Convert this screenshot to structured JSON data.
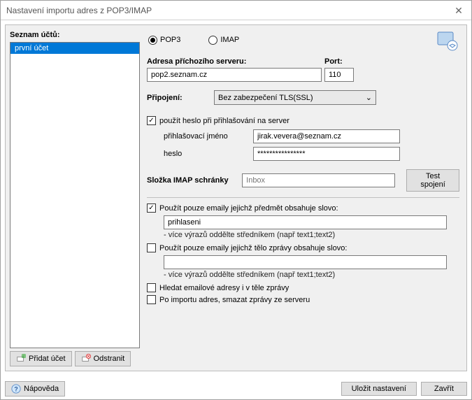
{
  "window": {
    "title": "Nastavení importu adres z POP3/IMAP"
  },
  "left": {
    "header": "Seznam účtů:",
    "accounts": [
      "první účet"
    ],
    "add_label": "Přidat účet",
    "remove_label": "Odstranit"
  },
  "radios": {
    "pop3": "POP3",
    "imap": "IMAP",
    "selected": "pop3"
  },
  "server": {
    "address_label": "Adresa příchozího serveru:",
    "port_label": "Port:",
    "address": "pop2.seznam.cz",
    "port": "110",
    "connection_label": "Připojení:",
    "connection_value": "Bez zabezpečení TLS(SSL)"
  },
  "auth": {
    "use_password_label": "použít heslo při přihlašování na server",
    "use_password_checked": true,
    "login_label": "přihlašovací jméno",
    "password_label": "heslo",
    "login": "jirak.vevera@seznam.cz",
    "password": "****************"
  },
  "imap_folder": {
    "label": "Složka IMAP schránky",
    "placeholder": "Inbox",
    "test_label": "Test spojení"
  },
  "filters": {
    "subject_checked": true,
    "subject_label": "Použít pouze emaily jejichž předmět obsahuje slovo:",
    "subject_value": "prihlaseni",
    "subject_hint": "- více výrazů oddělte středníkem (např text1;text2)",
    "body_checked": false,
    "body_label": "Použít pouze emaily jejichž tělo zprávy obsahuje slovo:",
    "body_value": "",
    "body_hint": "- více výrazů oddělte středníkem (např text1;text2)",
    "search_body_checked": false,
    "search_body_label": "Hledat emailové adresy i v těle zprávy",
    "delete_after_checked": false,
    "delete_after_label": "Po importu adres, smazat zprávy ze serveru"
  },
  "footer": {
    "help_label": "Nápověda",
    "save_label": "Uložit nastavení",
    "close_label": "Zavřít"
  }
}
